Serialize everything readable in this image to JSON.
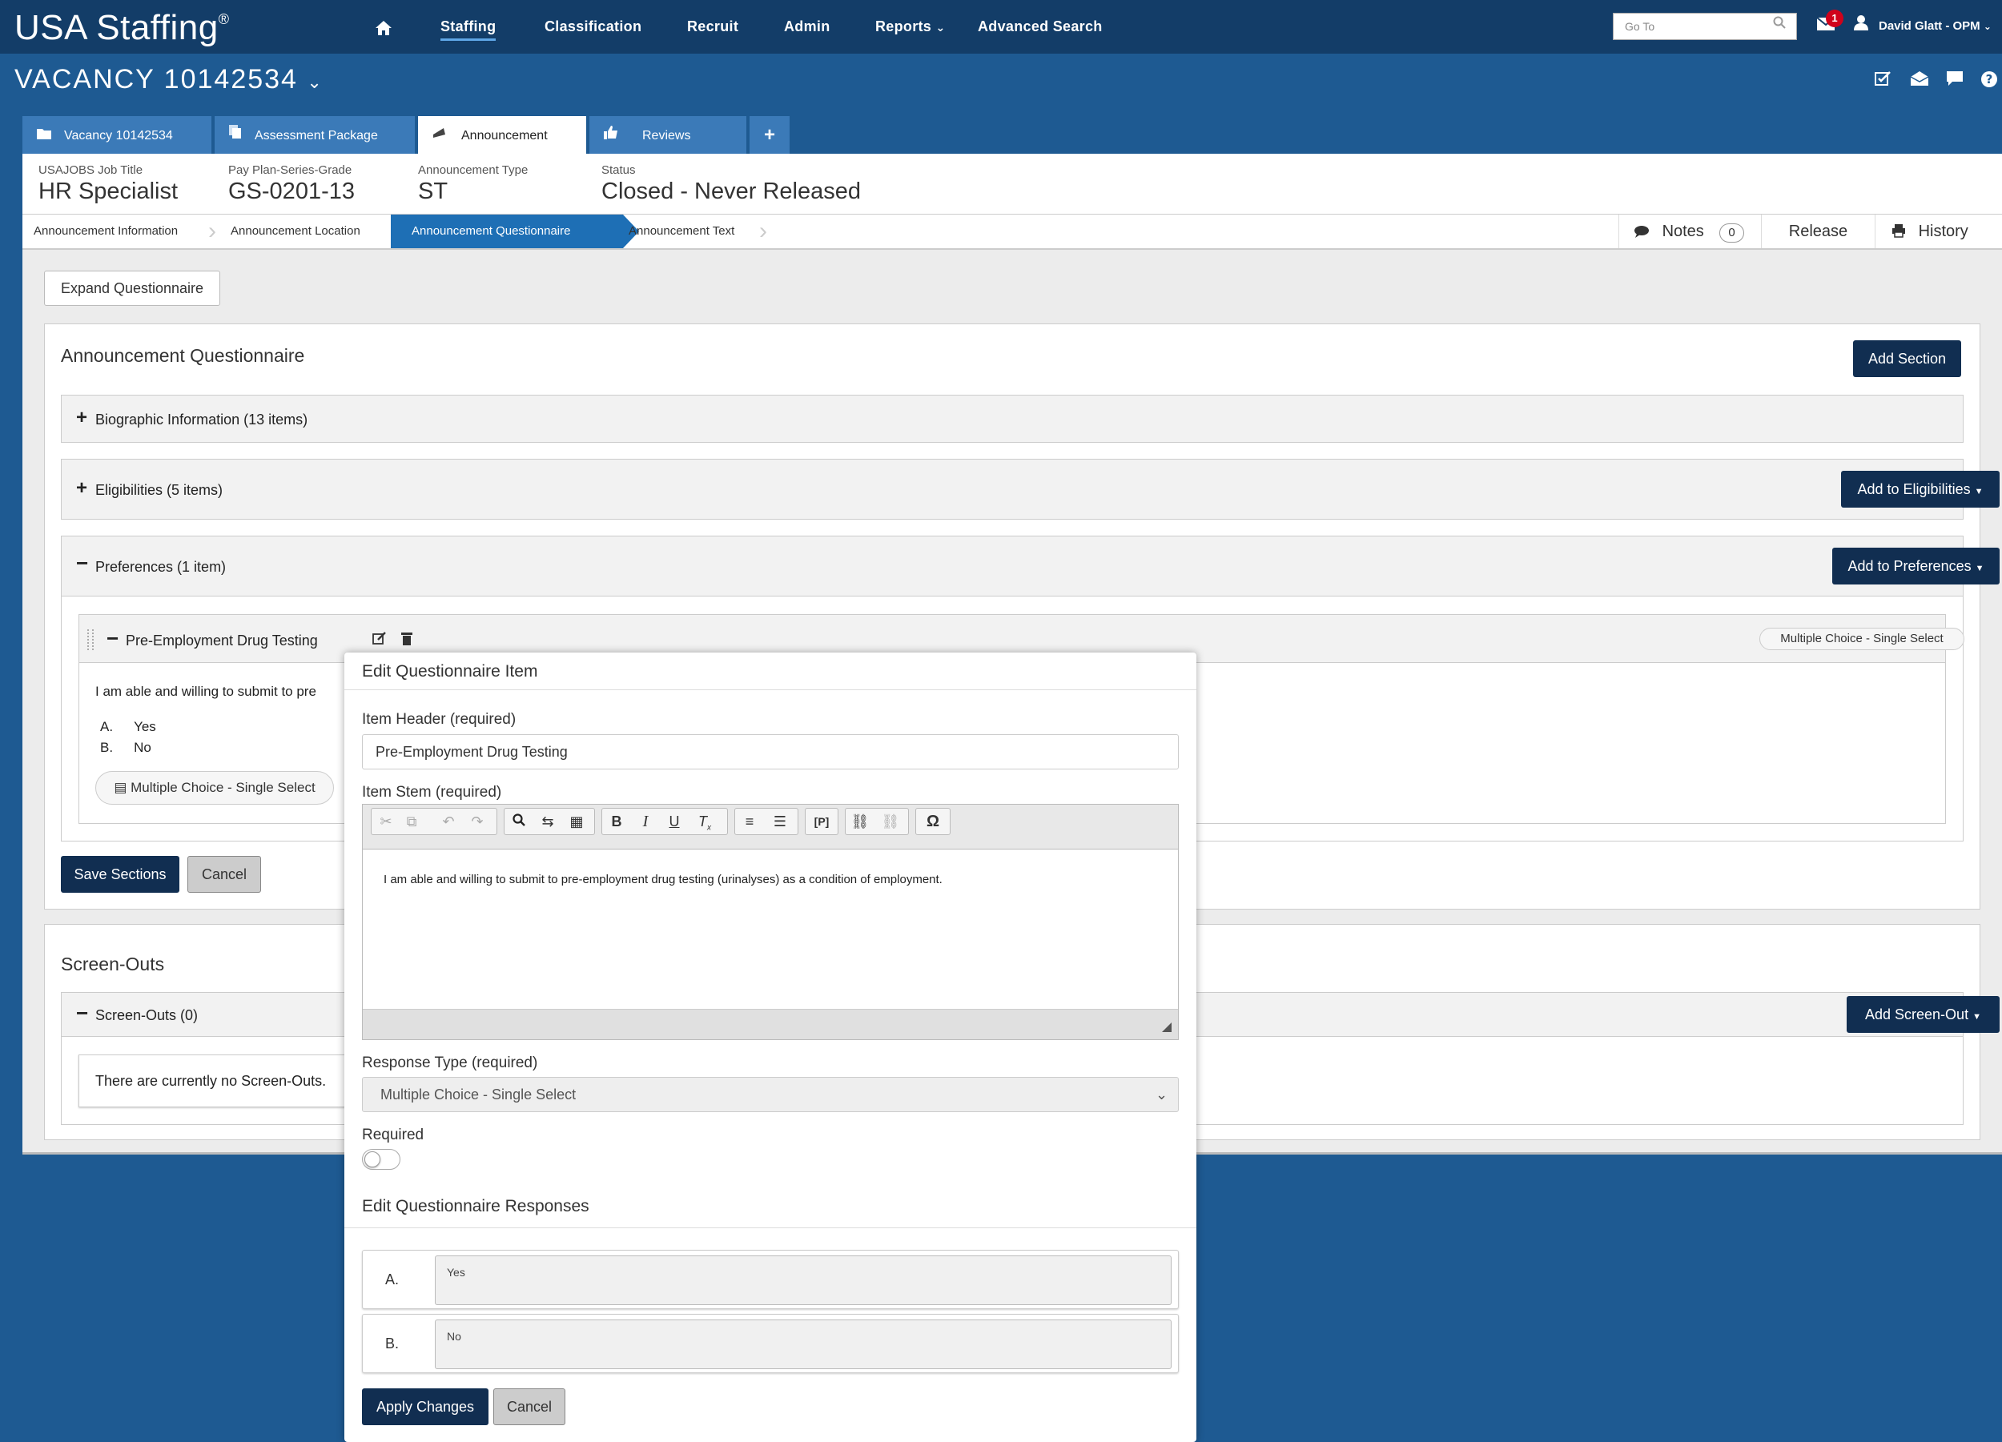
{
  "app": {
    "brand": "USA Staffing",
    "brand_mark": "®"
  },
  "nav": {
    "items": [
      "Staffing",
      "Classification",
      "Recruit",
      "Admin",
      "Reports",
      "Advanced Search"
    ],
    "active": "Staffing"
  },
  "goto": {
    "placeholder": "Go To"
  },
  "mail": {
    "badge": "1"
  },
  "user": {
    "name": "David Glatt - OPM"
  },
  "vacancy": {
    "title": "VACANCY 10142534"
  },
  "tabs": [
    {
      "label": "Vacancy 10142534",
      "icon": "folder-icon"
    },
    {
      "label": "Assessment Package",
      "icon": "documents-icon"
    },
    {
      "label": "Announcement",
      "icon": "megaphone-icon"
    },
    {
      "label": "Reviews",
      "icon": "thumbs-up-icon"
    }
  ],
  "info": {
    "job_title_label": "USAJOBS Job Title",
    "job_title": "HR Specialist",
    "ppsg_label": "Pay Plan-Series-Grade",
    "ppsg": "GS-0201-13",
    "type_label": "Announcement Type",
    "type": "ST",
    "status_label": "Status",
    "status": "Closed - Never Released"
  },
  "crumbs": [
    "Announcement Information",
    "Announcement Location",
    "Announcement Questionnaire",
    "Announcement Text"
  ],
  "crumb_actions": {
    "notes": "Notes",
    "notes_count": "0",
    "release": "Release",
    "history": "History"
  },
  "questionnaire": {
    "expand": "Expand Questionnaire",
    "heading": "Announcement Questionnaire",
    "add_section": "Add Section",
    "sections": {
      "bio": "Biographic Information (13 items)",
      "elig": "Eligibilities (5 items)",
      "elig_btn": "Add to Eligibilities",
      "pref": "Preferences (1 item)",
      "pref_btn": "Add to Preferences"
    },
    "item": {
      "header": "Pre-Employment Drug Testing",
      "type_badge": "Multiple Choice - Single Select",
      "stem_partial": "I am able and willing to submit to pre",
      "responses": [
        {
          "letter": "A.",
          "text": "Yes"
        },
        {
          "letter": "B.",
          "text": "No"
        }
      ],
      "type_pill": "Multiple Choice - Single Select"
    },
    "save": "Save Sections",
    "cancel": "Cancel"
  },
  "screenouts": {
    "heading": "Screen-Outs",
    "section": "Screen-Outs (0)",
    "add": "Add Screen-Out",
    "empty": "There are currently no Screen-Outs."
  },
  "modal": {
    "title": "Edit Questionnaire Item",
    "header_label": "Item Header (required)",
    "header_value": "Pre-Employment Drug Testing",
    "stem_label": "Item Stem (required)",
    "stem_value": "I am able and willing to submit to pre-employment drug testing (urinalyses) as a condition of employment.",
    "response_type_label": "Response Type (required)",
    "response_type_value": "Multiple Choice - Single Select",
    "required_label": "Required",
    "responses_heading": "Edit Questionnaire Responses",
    "responses": [
      {
        "letter": "A.",
        "text": "Yes"
      },
      {
        "letter": "B.",
        "text": "No"
      }
    ],
    "apply": "Apply Changes",
    "cancel": "Cancel"
  }
}
